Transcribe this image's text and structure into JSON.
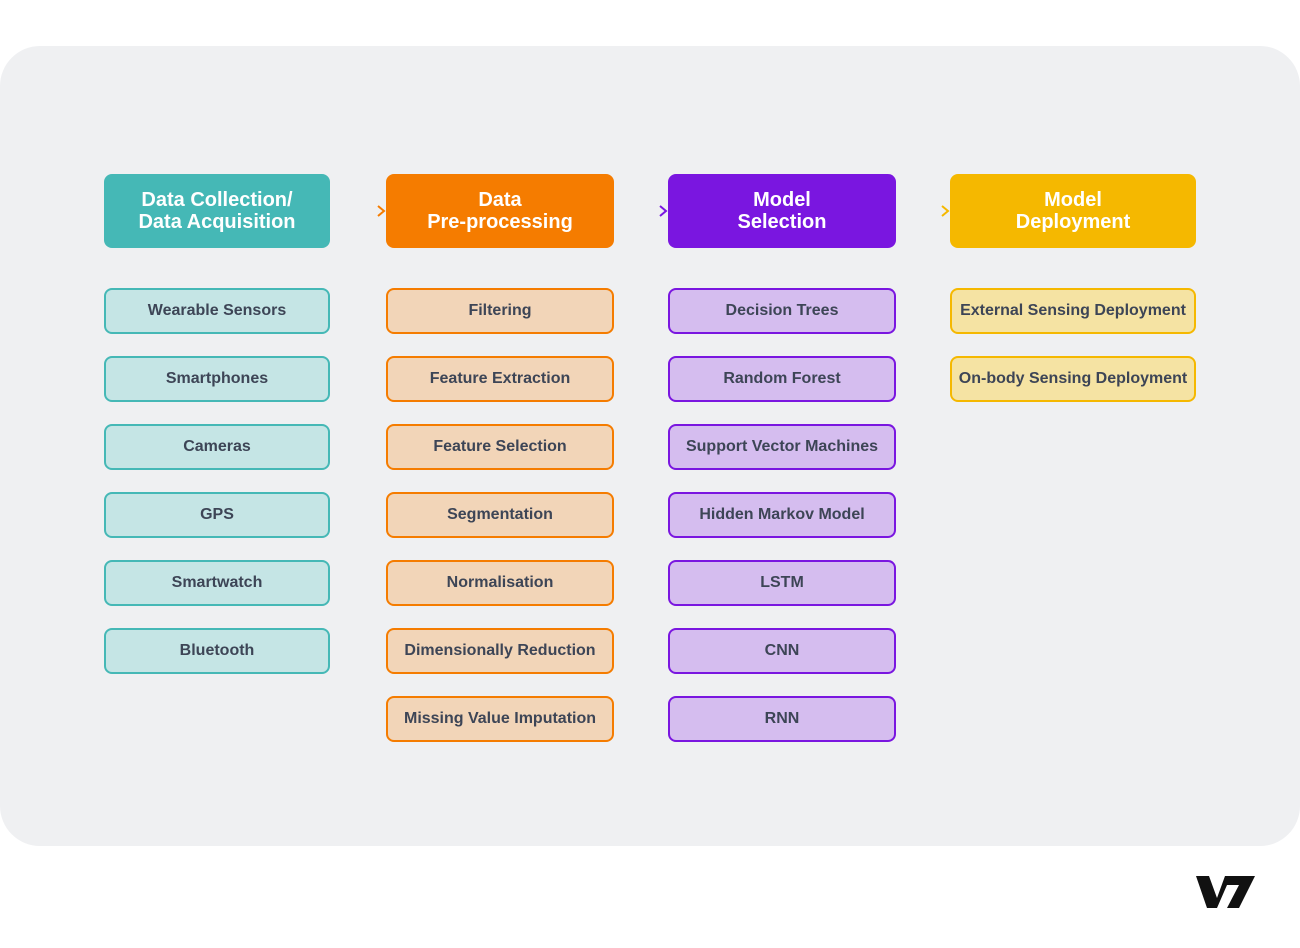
{
  "stages": [
    {
      "title": "Data Collection/\nData Acquisition",
      "color": "#45b8b6",
      "light": "#c5e5e5",
      "items": [
        "Wearable Sensors",
        "Smartphones",
        "Cameras",
        "GPS",
        "Smartwatch",
        "Bluetooth"
      ]
    },
    {
      "title": "Data\nPre-processing",
      "color": "#f57c00",
      "light": "#f2d5b8",
      "items": [
        "Filtering",
        "Feature Extraction",
        "Feature Selection",
        "Segmentation",
        "Normalisation",
        "Dimensionally Reduction",
        "Missing Value Imputation"
      ]
    },
    {
      "title": "Model\nSelection",
      "color": "#7a16e0",
      "light": "#d5bdef",
      "items": [
        "Decision Trees",
        "Random Forest",
        "Support Vector Machines",
        "Hidden Markov Model",
        "LSTM",
        "CNN",
        "RNN"
      ]
    },
    {
      "title": "Model\nDeployment",
      "color": "#f5b800",
      "light": "#f5e3a3",
      "items": [
        "External Sensing Deployment",
        "On-body Sensing Deployment"
      ]
    }
  ],
  "logo": "V7"
}
